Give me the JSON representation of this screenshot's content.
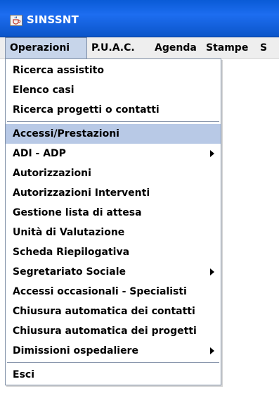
{
  "window": {
    "title": "SINSSNT",
    "icon": "java-cup-icon"
  },
  "menubar": {
    "items": [
      "Operazioni",
      "P.U.A.C.",
      "Agenda",
      "Stampe",
      "S"
    ]
  },
  "dropdown": {
    "groups": [
      [
        "Ricerca assistito",
        "Elenco casi",
        "Ricerca progetti o contatti"
      ],
      [
        "Accessi/Prestazioni",
        "ADI - ADP",
        "Autorizzazioni",
        "Autorizzazioni Interventi",
        "Gestione lista di attesa",
        "Unità di Valutazione",
        "Scheda Riepilogativa",
        "Segretariato Sociale",
        "Accessi occasionali - Specialisti",
        "Chiusura automatica dei contatti",
        "Chiusura automatica dei progetti",
        "Dimissioni ospedaliere"
      ],
      [
        "Esci"
      ]
    ],
    "highlighted": "Accessi/Prestazioni",
    "submenu_items": [
      "ADI - ADP",
      "Segretariato Sociale",
      "Dimissioni ospedaliere"
    ],
    "submenu_icon": "submenu-arrow-icon"
  }
}
